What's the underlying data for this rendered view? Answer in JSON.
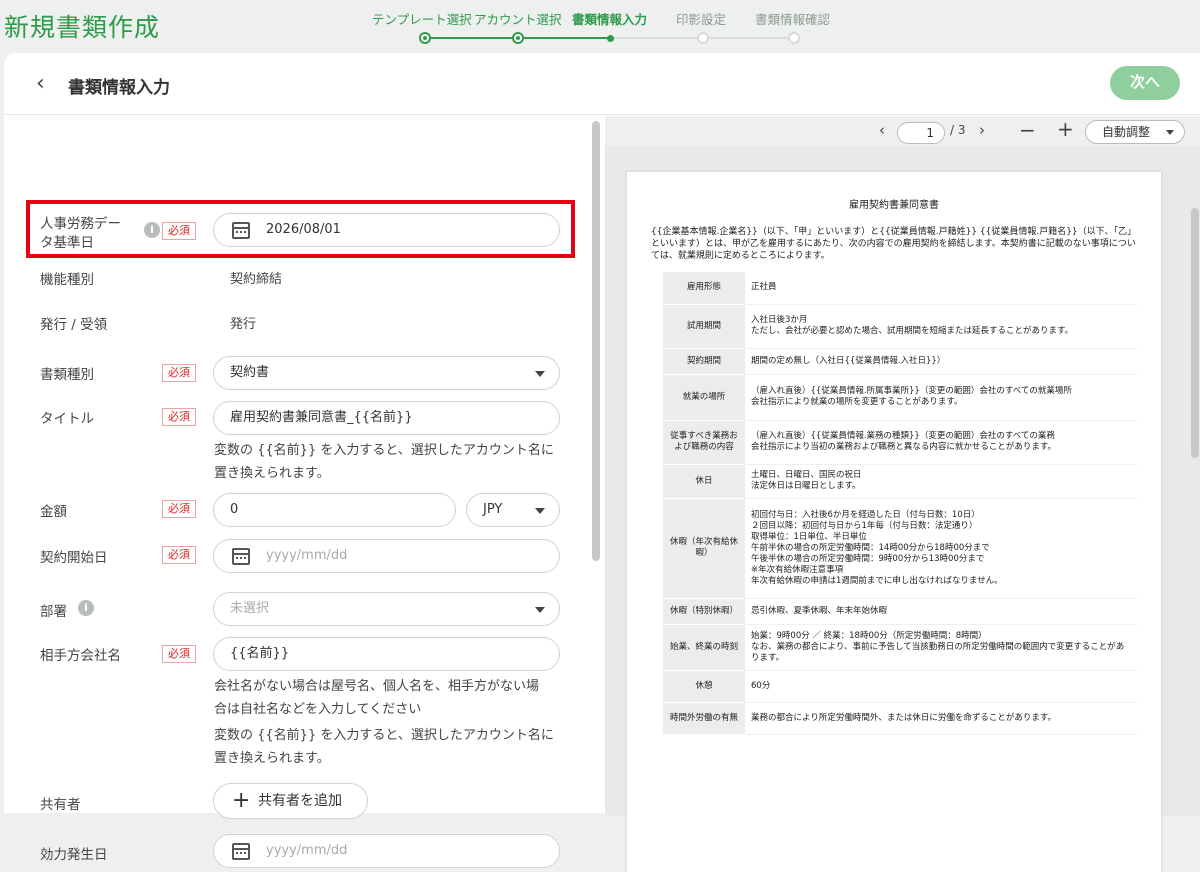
{
  "app_title": "新規書類作成",
  "steps": [
    "テンプレート選択",
    "アカウント選択",
    "書類情報入力",
    "印影設定",
    "書類情報確認"
  ],
  "header": {
    "back_icon": "chevron-left-icon",
    "title": "書類情報入力",
    "next_label": "次へ"
  },
  "required_badge": "必須",
  "form": {
    "data_date": {
      "label_line1": "人事労務デー",
      "label_line2": "タ基準日",
      "value": "2026/08/01"
    },
    "function_type": {
      "label": "機能種別",
      "value": "契約締結"
    },
    "issue": {
      "label": "発行 / 受領",
      "value": "発行"
    },
    "doc_type": {
      "label": "書類種別",
      "value": "契約書"
    },
    "title": {
      "label": "タイトル",
      "value": "雇用契約書兼同意書_{{名前}}",
      "help1": "変数の {{名前}} を入力すると、選択したアカウント名に",
      "help2": "置き換えられます。"
    },
    "amount": {
      "label": "金額",
      "value": "0",
      "currency": "JPY"
    },
    "start_date": {
      "label": "契約開始日",
      "placeholder": "yyyy/mm/dd"
    },
    "department": {
      "label": "部署",
      "placeholder": "未選択"
    },
    "partner": {
      "label": "相手方会社名",
      "value": "{{名前}}",
      "help1": "会社名がない場合は屋号名、個人名を、相手方がない場",
      "help2": "合は自社名などを入力してください",
      "help3": "変数の {{名前}} を入力すると、選択したアカウント名に",
      "help4": "置き換えられます。"
    },
    "sharer": {
      "label": "共有者",
      "button": "共有者を追加"
    },
    "effective_date": {
      "label": "効力発生日",
      "placeholder": "yyyy/mm/dd"
    }
  },
  "viewer": {
    "page_current": "1",
    "page_total": "/ 3",
    "zoom": "自動調整"
  },
  "document": {
    "title": "雇用契約書兼同意書",
    "intro": "{{企業基本情報.企業名}}（以下、「甲」といいます）と{{従業員情報.戸籍姓}} {{従業員情報.戸籍名}}（以下、「乙」といいます）とは、甲が乙を雇用するにあたり、次の内容での雇用契約を締結します。本契約書に記載のない事項については、就業規則に定めるところによります。",
    "rows": [
      {
        "k": "雇用形態",
        "v": "正社員"
      },
      {
        "k": "試用期間",
        "v": "入社日後3か月\nただし、会社が必要と認めた場合、試用期間を短縮または延長することがあります。"
      },
      {
        "k": "契約期間",
        "v": "期間の定め無し（入社日{{従業員情報.入社日}}）"
      },
      {
        "k": "就業の場所",
        "v": "（雇入れ直後）{{従業員情報.所属事業所}}（変更の範囲）会社のすべての就業場所\n会社指示により就業の場所を変更することがあります。"
      },
      {
        "k": "従事すべき業務および職務の内容",
        "v": "（雇入れ直後）{{従業員情報.業務の種類}}（変更の範囲）会社のすべての業務\n会社指示により当初の業務および職務と異なる内容に就かせることがあります。"
      },
      {
        "k": "休日",
        "v": "土曜日、日曜日、国民の祝日\n法定休日は日曜日とします。"
      },
      {
        "k": "休暇（年次有給休暇）",
        "v": "初回付与日：入社後6か月を経過した日（付与日数：10日）\n２回目以降：初回付与日から1年毎（付与日数：法定通り）\n取得単位：1日単位、半日単位\n午前半休の場合の所定労働時間：14時00分から18時00分まで\n午後半休の場合の所定労働時間：9時00分から13時00分まで\n※年次有給休暇注意事項\n年次有給休暇の申請は1週間前までに申し出なければなりません。"
      },
      {
        "k": "休暇（特別休暇）",
        "v": "忌引休暇、夏季休暇、年末年始休暇"
      },
      {
        "k": "始業、終業の時刻",
        "v": "始業：9時00分 ／ 終業：18時00分（所定労働時間：8時間）\nなお、業務の都合により、事前に予告して当該勤務日の所定労働時間の範囲内で変更することがあります。"
      },
      {
        "k": "休憩",
        "v": "60分"
      },
      {
        "k": "時間外労働の有無",
        "v": "業務の都合により所定労働時間外、または休日に労働を命ずることがあります。"
      }
    ]
  },
  "colors": {
    "brand": "#2e9a4a",
    "next_button": "#8fcf9e",
    "required": "#dd2222",
    "highlight": "#e60012"
  }
}
